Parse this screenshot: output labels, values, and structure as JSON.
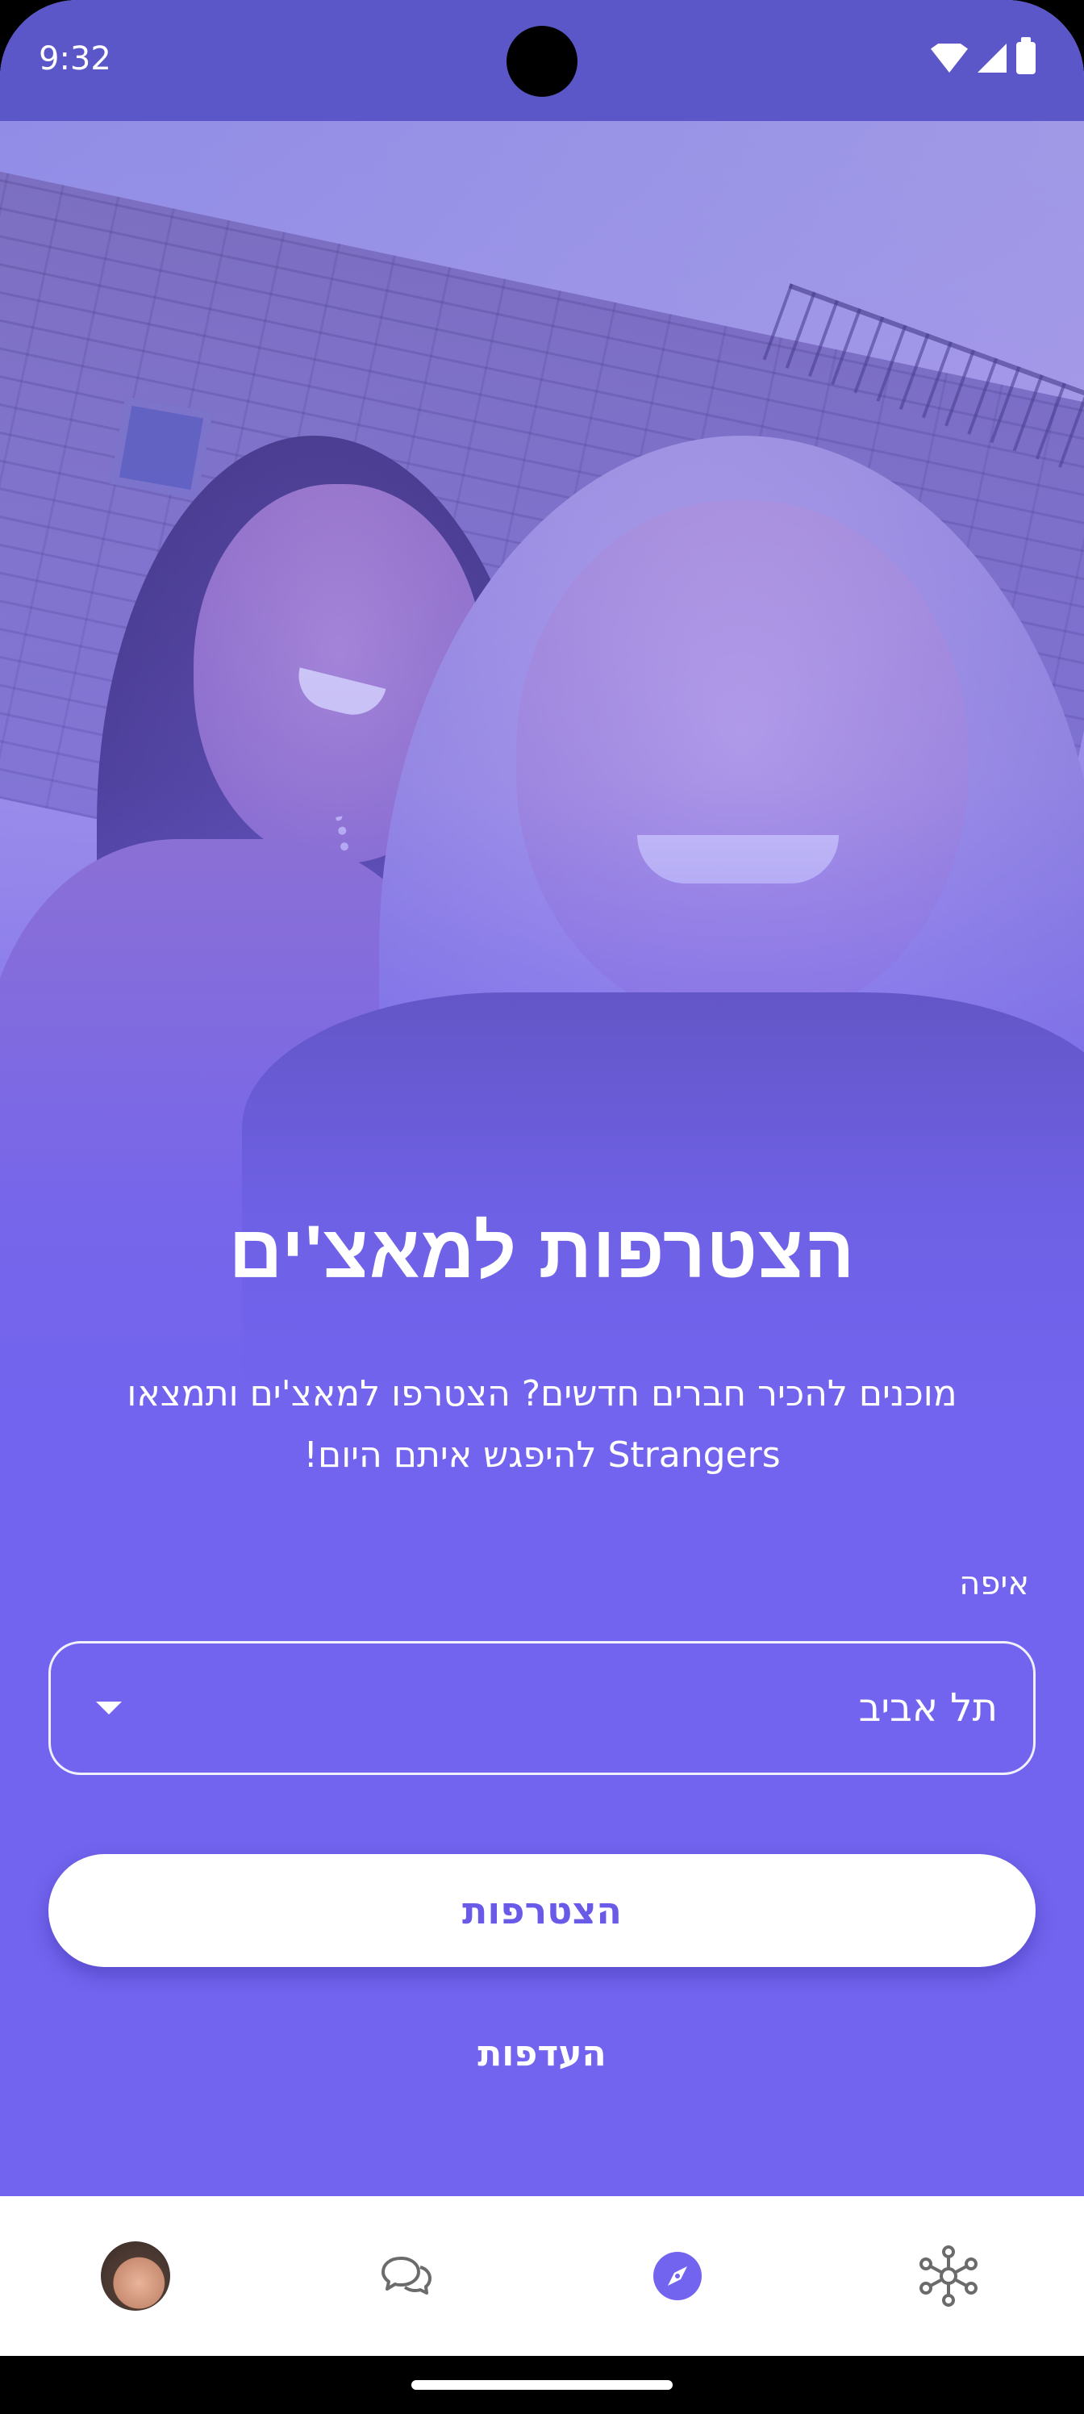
{
  "status_bar": {
    "time": "9:32"
  },
  "hero": {
    "title": "הצטרפות למאצ'ים",
    "description": "מוכנים להכיר חברים חדשים? הצטרפו למאצ'ים ותמצאו Strangers להיפגש איתם היום!"
  },
  "form": {
    "location_label": "איפה",
    "location_value": "תל אביב",
    "join_button": "הצטרפות",
    "preferences_link": "העדפות"
  },
  "bottom_nav": {
    "items": [
      {
        "name": "profile",
        "icon": "avatar"
      },
      {
        "name": "chats",
        "icon": "chat-bubbles-icon"
      },
      {
        "name": "discover",
        "icon": "compass-icon",
        "active": true
      },
      {
        "name": "network",
        "icon": "network-icon"
      }
    ]
  },
  "colors": {
    "accent": "#7264ee",
    "status_bar": "#5c57c9",
    "button_text": "#6a5ae8"
  }
}
